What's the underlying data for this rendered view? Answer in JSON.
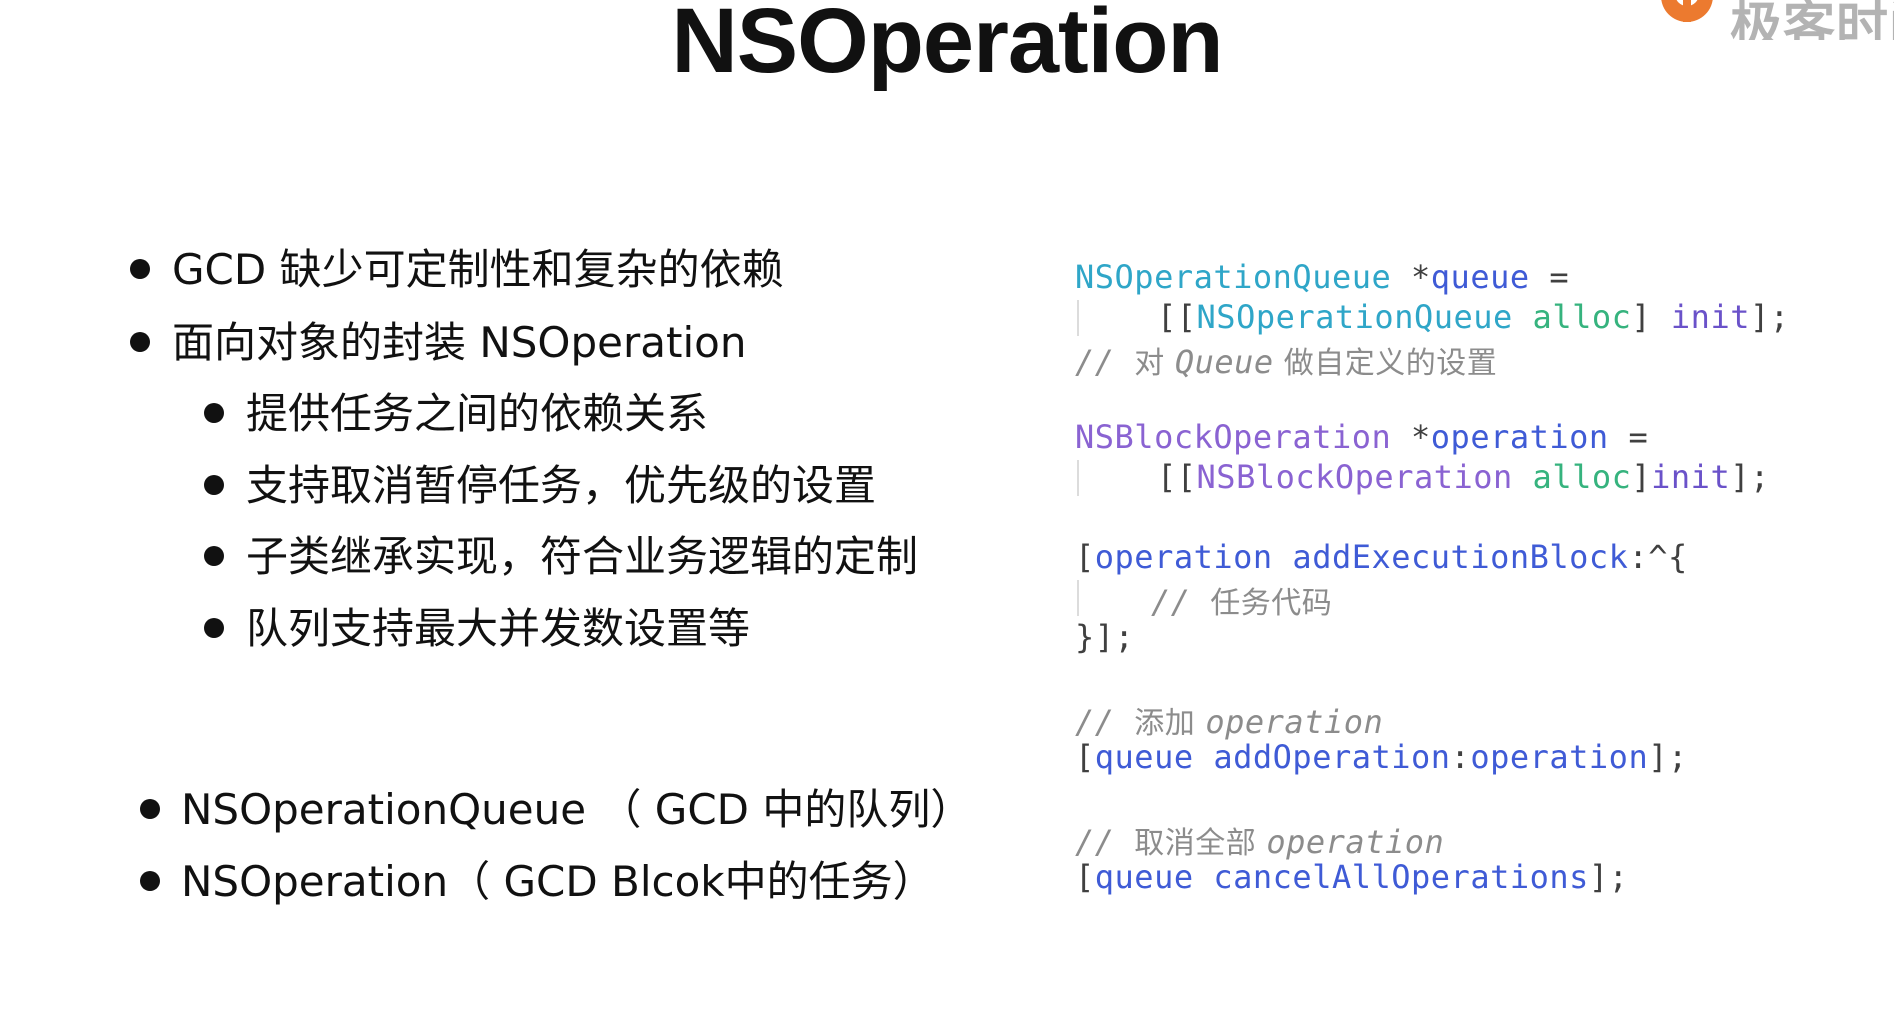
{
  "slide": {
    "title": "NSOperation",
    "logo_text": "极客时间"
  },
  "bullets": {
    "level1_a": "GCD 缺少可定制性和复杂的依赖",
    "level1_b": "面向对象的封装 NSOperation",
    "sub_items": [
      "提供任务之间的依赖关系",
      "支持取消暂停任务，优先级的设置",
      "子类继承实现，符合业务逻辑的定制",
      "队列支持最大并发数设置等"
    ],
    "mapping": [
      "NSOperationQueue （ GCD 中的队列）",
      "NSOperation（ GCD Blcok中的任务）"
    ]
  },
  "code": {
    "l1_class": "NSOperationQueue",
    "l1_star": " *",
    "l1_var": "queue",
    "l1_eq": " =",
    "l2_open": "[[",
    "l2_class": "NSOperationQueue",
    "l2_alloc": " alloc",
    "l2_close": "] ",
    "l2_init": "init",
    "l2_end": "];",
    "l3_slashes": "// ",
    "l3_cn1": "对 ",
    "l3_word": "Queue",
    "l3_cn2": " 做自定义的设置",
    "l4_class": "NSBlockOperation",
    "l4_star": " *",
    "l4_var": "operation",
    "l4_eq": " =",
    "l5_open": "[[",
    "l5_class": "NSBlockOperation",
    "l5_alloc": " alloc",
    "l5_close": "]",
    "l5_init": "init",
    "l5_end": "];",
    "l6_open": "[",
    "l6_var": "operation",
    "l6_method": " addExecutionBlock",
    "l6_rest": ":^{",
    "l7_slashes": "// ",
    "l7_cn": "任务代码",
    "l8": "}];",
    "l9_slashes": "// ",
    "l9_cn": "添加 ",
    "l9_word": "operation",
    "l10_open": "[",
    "l10_var": "queue",
    "l10_method": " addOperation",
    "l10_colon": ":",
    "l10_arg": "operation",
    "l10_end": "];",
    "l11_slashes": "// ",
    "l11_cn": "取消全部 ",
    "l11_word": "operation",
    "l12_open": "[",
    "l12_var": "queue",
    "l12_method": " cancelAllOperations",
    "l12_end": "];"
  }
}
